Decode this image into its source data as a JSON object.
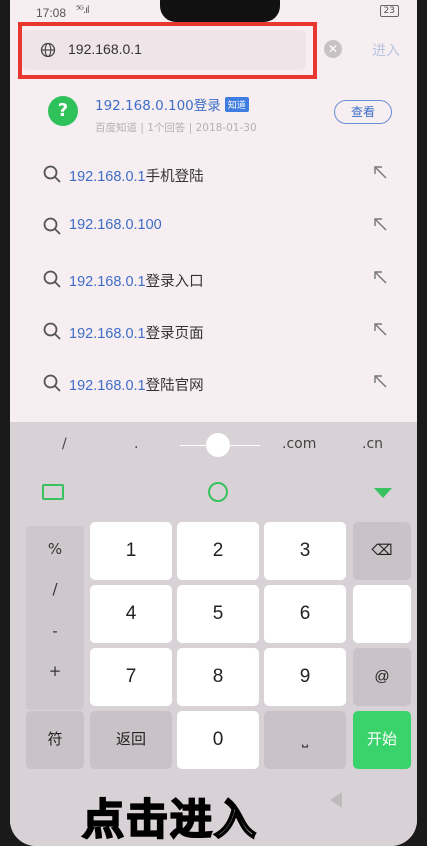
{
  "status": {
    "time": "17:08",
    "signal": "⁵ᴳ.ıl",
    "battery": "23"
  },
  "urlbar": {
    "value": "192.168.0.1",
    "clear": "✕",
    "enter": "进入"
  },
  "qa": {
    "title": "192.168.0.100登录",
    "tag": "知道",
    "meta": "百度知道 | 1个回答 | 2018-01-30",
    "button": "查看"
  },
  "suggestions": [
    {
      "hl": "192.168.0.1",
      "rest": "手机登陆"
    },
    {
      "hl": "192.168.0.100",
      "rest": ""
    },
    {
      "hl": "192.168.0.1",
      "rest": "登录入口"
    },
    {
      "hl": "192.168.0.1",
      "rest": "登录页面"
    },
    {
      "hl": "192.168.0.1",
      "rest": "登陆官网"
    }
  ],
  "keyboard": {
    "top": {
      "slash": "/",
      "dot": ".",
      "com": ".com",
      "cn": ".cn"
    },
    "symbols": [
      "%",
      "/",
      "-",
      "+"
    ],
    "digits": [
      "1",
      "2",
      "3",
      "4",
      "5",
      "6",
      "7",
      "8",
      "9",
      "0"
    ],
    "at": "@",
    "fu": "符",
    "back": "返回",
    "start": "开始",
    "space": "⎵",
    "backspace": "⌫"
  },
  "subtitle": "点击进入",
  "colors": {
    "accent": "#3e6ec7",
    "green": "#39c160",
    "highlight": "#e8372f"
  }
}
